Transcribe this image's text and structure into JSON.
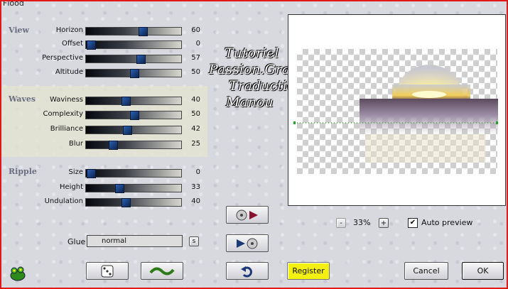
{
  "window": {
    "title": "Flood"
  },
  "sections": {
    "view": {
      "label": "View"
    },
    "waves": {
      "label": "Waves"
    },
    "ripple": {
      "label": "Ripple"
    }
  },
  "sliders": {
    "horizon": {
      "label": "Horizon",
      "value": "60",
      "min": 0,
      "max": 100
    },
    "offset": {
      "label": "Offset",
      "value": "0",
      "min": 0,
      "max": 100
    },
    "perspective": {
      "label": "Perspective",
      "value": "57",
      "min": 0,
      "max": 100
    },
    "altitude": {
      "label": "Altitude",
      "value": "50",
      "min": 0,
      "max": 100
    },
    "waviness": {
      "label": "Waviness",
      "value": "40",
      "min": 0,
      "max": 100
    },
    "complexity": {
      "label": "Complexity",
      "value": "50",
      "min": 0,
      "max": 100
    },
    "brilliance": {
      "label": "Brilliance",
      "value": "42",
      "min": 0,
      "max": 100
    },
    "blur": {
      "label": "Blur",
      "value": "25",
      "min": 0,
      "max": 100
    },
    "size": {
      "label": "Size",
      "value": "0",
      "min": 0,
      "max": 100
    },
    "height": {
      "label": "Height",
      "value": "33",
      "min": 0,
      "max": 100
    },
    "undulation": {
      "label": "Undulation",
      "value": "40",
      "min": 0,
      "max": 100
    }
  },
  "glue": {
    "label": "Glue",
    "value": "normal",
    "dropdown_button": "s"
  },
  "watermark": {
    "lines": [
      "Tutoriel",
      "Passion.Graphic",
      "Traduction",
      "Manou"
    ]
  },
  "zoom": {
    "minus": "-",
    "value": "33%",
    "plus": "+"
  },
  "auto_preview": {
    "label": "Auto preview",
    "checked": true,
    "check_mark": "✔"
  },
  "buttons": {
    "register": "Register",
    "cancel": "Cancel",
    "ok": "OK"
  },
  "colors": {
    "accent": "#e01818",
    "register_bg": "#f4f010",
    "slider_thumb": "#1c4a8c"
  }
}
